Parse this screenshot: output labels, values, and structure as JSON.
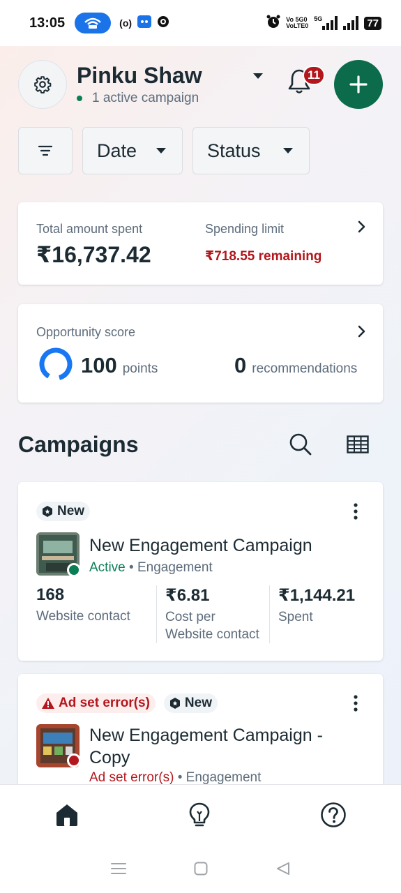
{
  "status_bar": {
    "time": "13:05",
    "net_top": "Vo 5G0",
    "net_bottom": "VoLTE0",
    "net_5g": "5G",
    "battery": "77"
  },
  "header": {
    "account_name": "Pinku Shaw",
    "active_campaigns": "1 active campaign",
    "notification_count": "11"
  },
  "filters": {
    "date_label": "Date",
    "status_label": "Status"
  },
  "spend": {
    "total_label": "Total amount spent",
    "total_value": "₹16,737.42",
    "limit_label": "Spending limit",
    "limit_value": "₹718.55 remaining"
  },
  "opportunity": {
    "label": "Opportunity score",
    "points": "100",
    "points_unit": "points",
    "recommendations": "0",
    "recommendations_unit": "recommendations"
  },
  "campaigns": {
    "title": "Campaigns",
    "items": [
      {
        "badge": "New",
        "name": "New Engagement Campaign",
        "status": "Active",
        "objective": "Engagement",
        "metrics": [
          {
            "value": "168",
            "label": "Website contact"
          },
          {
            "value": "₹6.81",
            "label": "Cost per Website contact"
          },
          {
            "value": "₹1,144.21",
            "label": "Spent"
          }
        ]
      },
      {
        "error_badge": "Ad set error(s)",
        "badge": "New",
        "name": "New Engagement Campaign - Copy",
        "status": "Ad set error(s)",
        "objective": "Engagement"
      }
    ]
  },
  "colors": {
    "primary_green": "#0b6b4b",
    "active_green": "#0a7f55",
    "error_red": "#b3171d",
    "ring_blue": "#1877f2"
  }
}
